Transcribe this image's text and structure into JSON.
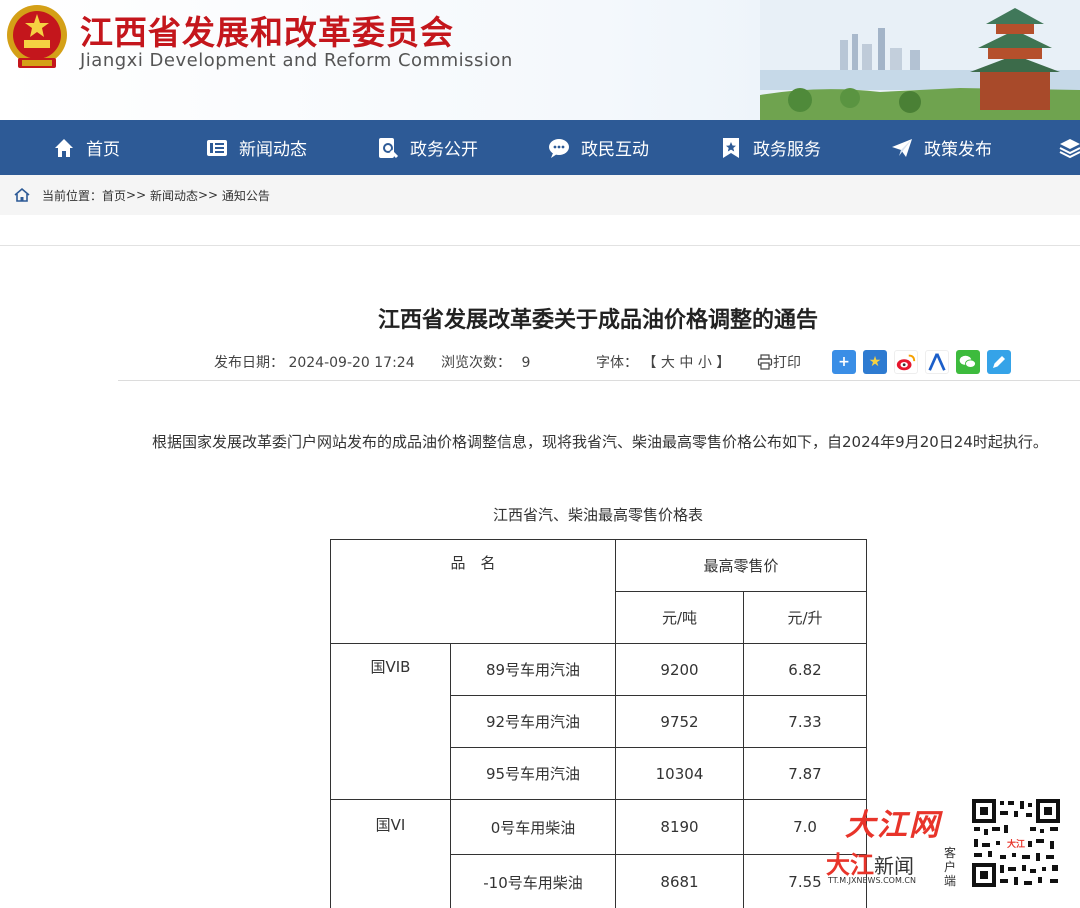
{
  "header": {
    "title": "江西省发展和改革委员会",
    "subtitle": "Jiangxi Development and Reform Commission"
  },
  "nav": [
    {
      "label": "首页",
      "icon": "home-icon"
    },
    {
      "label": "新闻动态",
      "icon": "news-icon"
    },
    {
      "label": "政务公开",
      "icon": "document-search-icon"
    },
    {
      "label": "政民互动",
      "icon": "chat-icon"
    },
    {
      "label": "政务服务",
      "icon": "bookmark-star-icon"
    },
    {
      "label": "政策发布",
      "icon": "paper-plane-icon"
    }
  ],
  "breadcrumb": {
    "prefix": "当前位置：",
    "items": [
      "首页",
      "新闻动态",
      "通知公告"
    ],
    "sep": ">>"
  },
  "article": {
    "title": "江西省发展改革委关于成品油价格调整的通告",
    "date_label": "发布日期：",
    "date": "2024-09-20 17:24",
    "views_label": "浏览次数：",
    "views": "9",
    "font_label": "字体：",
    "font_open": "【",
    "font_large": "大",
    "font_medium": "中",
    "font_small": "小",
    "font_close": "】",
    "print": "打印",
    "paragraph": "根据国家发展改革委门户网站发布的成品油价格调整信息，现将我省汽、柴油最高零售价格公布如下，自2024年9月20日24时起执行。",
    "table_caption": "江西省汽、柴油最高零售价格表"
  },
  "share_icons": [
    "plus-share-icon",
    "star-share-icon",
    "weibo-icon",
    "renren-icon",
    "wechat-icon",
    "edit-icon"
  ],
  "table": {
    "header_name": "品　名",
    "header_price": "最高零售价",
    "unit_ton": "元/吨",
    "unit_liter": "元/升",
    "groups": [
      {
        "standard": "国VIB",
        "rows": [
          {
            "name": "89号车用汽油",
            "ton": "9200",
            "liter": "6.82"
          },
          {
            "name": "92号车用汽油",
            "ton": "9752",
            "liter": "7.33"
          },
          {
            "name": "95号车用汽油",
            "ton": "10304",
            "liter": "7.87"
          }
        ]
      },
      {
        "standard": "国VI",
        "rows": [
          {
            "name": "0号车用柴油",
            "ton": "8190",
            "liter": "7.0"
          },
          {
            "name": "-10号车用柴油",
            "ton": "8681",
            "liter": "7.55"
          }
        ]
      }
    ]
  },
  "ad": {
    "logo1": "大江网",
    "logo2_red": "大江",
    "logo2_black": "新闻",
    "url": "TT.M.JXNEWS.COM.CN",
    "client": "客户端"
  },
  "colors": {
    "nav_bg": "#2d5a96",
    "title_red": "#c4161c",
    "ad_red": "#e8342a"
  }
}
